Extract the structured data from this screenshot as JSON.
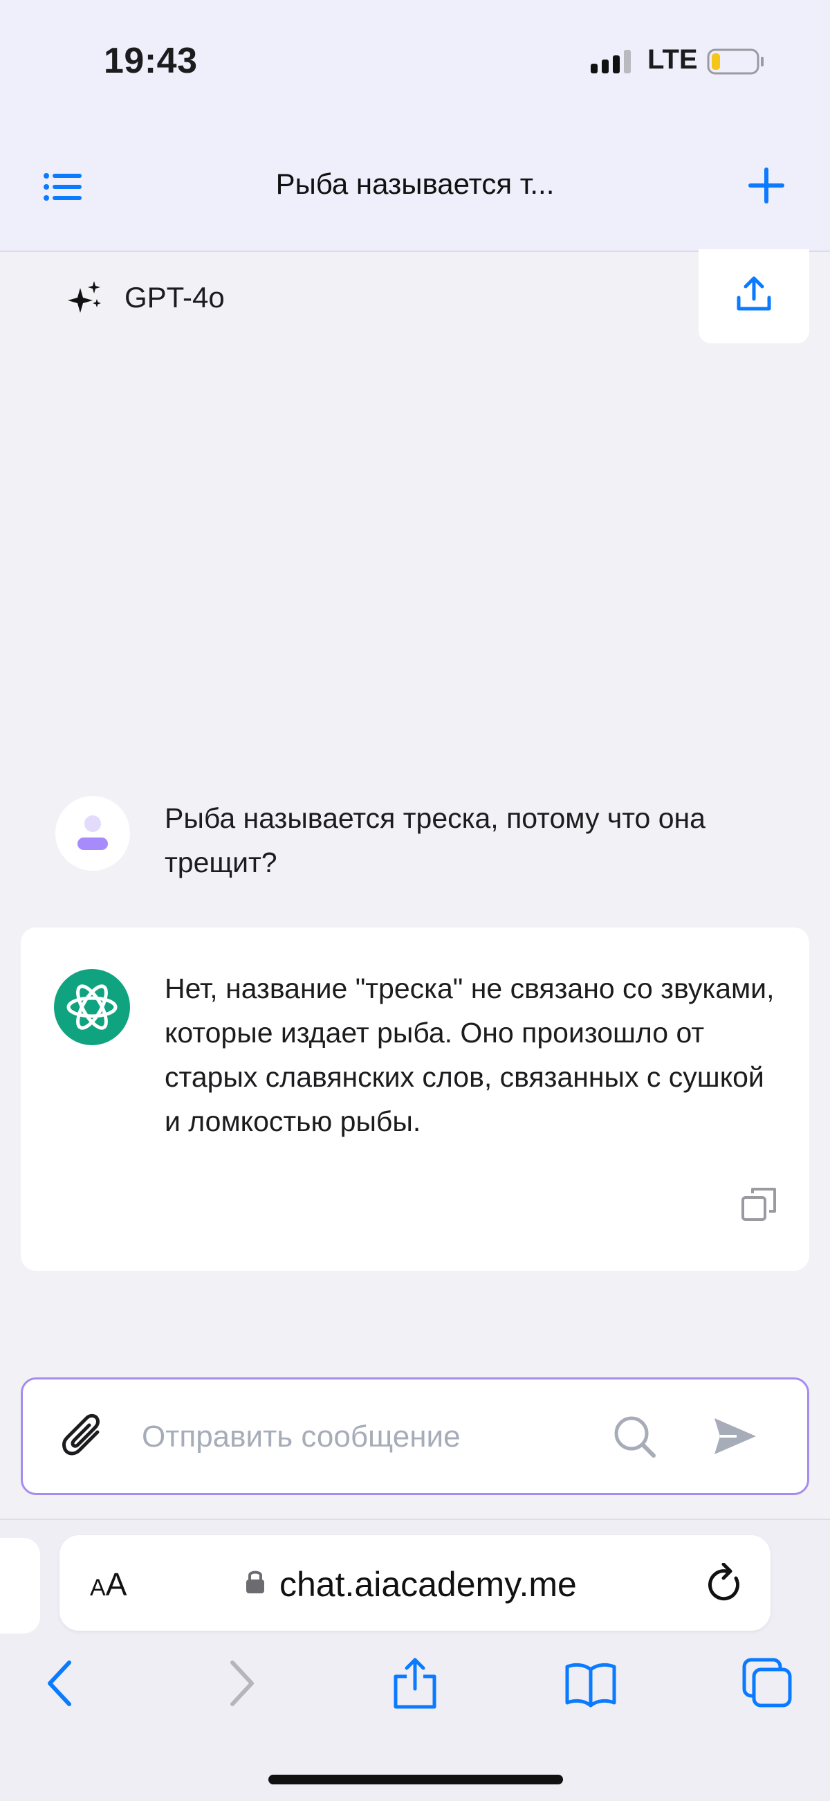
{
  "status_bar": {
    "time": "19:43",
    "network": "LTE"
  },
  "header": {
    "title": "Рыба называется т...",
    "menu_icon": "list-menu-icon",
    "new_chat_icon": "plus-icon"
  },
  "model": {
    "label": "GPT-4o",
    "icon": "sparkles-icon",
    "share_icon": "upload-icon"
  },
  "messages": [
    {
      "role": "user",
      "text": "Рыба называется треска, потому что она трещит?"
    },
    {
      "role": "assistant",
      "text": "Нет, название \"треска\" не связано со звуками, которые издает рыба. Оно произошло от старых славянских слов, связанных с сушкой и ломкостью рыбы."
    }
  ],
  "composer": {
    "placeholder": "Отправить сообщение",
    "value": ""
  },
  "browser": {
    "text_size_label_small": "A",
    "text_size_label_large": "A",
    "url": "chat.aiacademy.me"
  },
  "colors": {
    "accent_blue": "#0a7aff",
    "header_bg": "#efeefb",
    "composer_border": "#a68bf0",
    "openai_green": "#10a37f",
    "user_avatar_purple": "#a78bfa"
  }
}
